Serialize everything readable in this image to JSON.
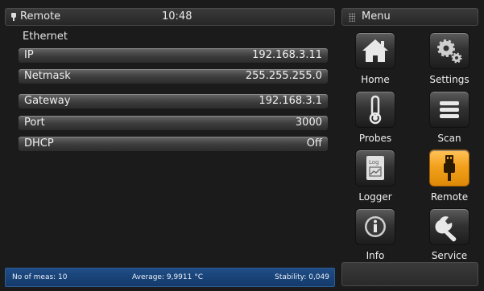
{
  "header": {
    "mode": "Remote",
    "time": "10:48",
    "menu_title": "Menu"
  },
  "section": {
    "label": "Ethernet"
  },
  "fields": [
    {
      "key": "IP",
      "value": "192.168.3.11"
    },
    {
      "key": "Netmask",
      "value": "255.255.255.0"
    },
    {
      "key": "Gateway",
      "value": "192.168.3.1"
    },
    {
      "key": "Port",
      "value": "3000"
    },
    {
      "key": "DHCP",
      "value": "Off"
    }
  ],
  "menu": [
    {
      "label": "Home",
      "icon": "home-icon"
    },
    {
      "label": "Settings",
      "icon": "gears-icon"
    },
    {
      "label": "Probes",
      "icon": "thermometer-icon"
    },
    {
      "label": "Scan",
      "icon": "list-icon"
    },
    {
      "label": "Logger",
      "icon": "logger-icon"
    },
    {
      "label": "Remote",
      "icon": "usb-plug-icon",
      "active": true
    },
    {
      "label": "Info",
      "icon": "info-icon"
    },
    {
      "label": "Service",
      "icon": "wrench-icon"
    }
  ],
  "status": {
    "meas": "No of meas: 10",
    "average": "Average: 9,9911 °C",
    "stability": "Stability: 0,049"
  },
  "colors": {
    "active_tile": "#f3a11c",
    "status_bar": "#1f4d86"
  }
}
